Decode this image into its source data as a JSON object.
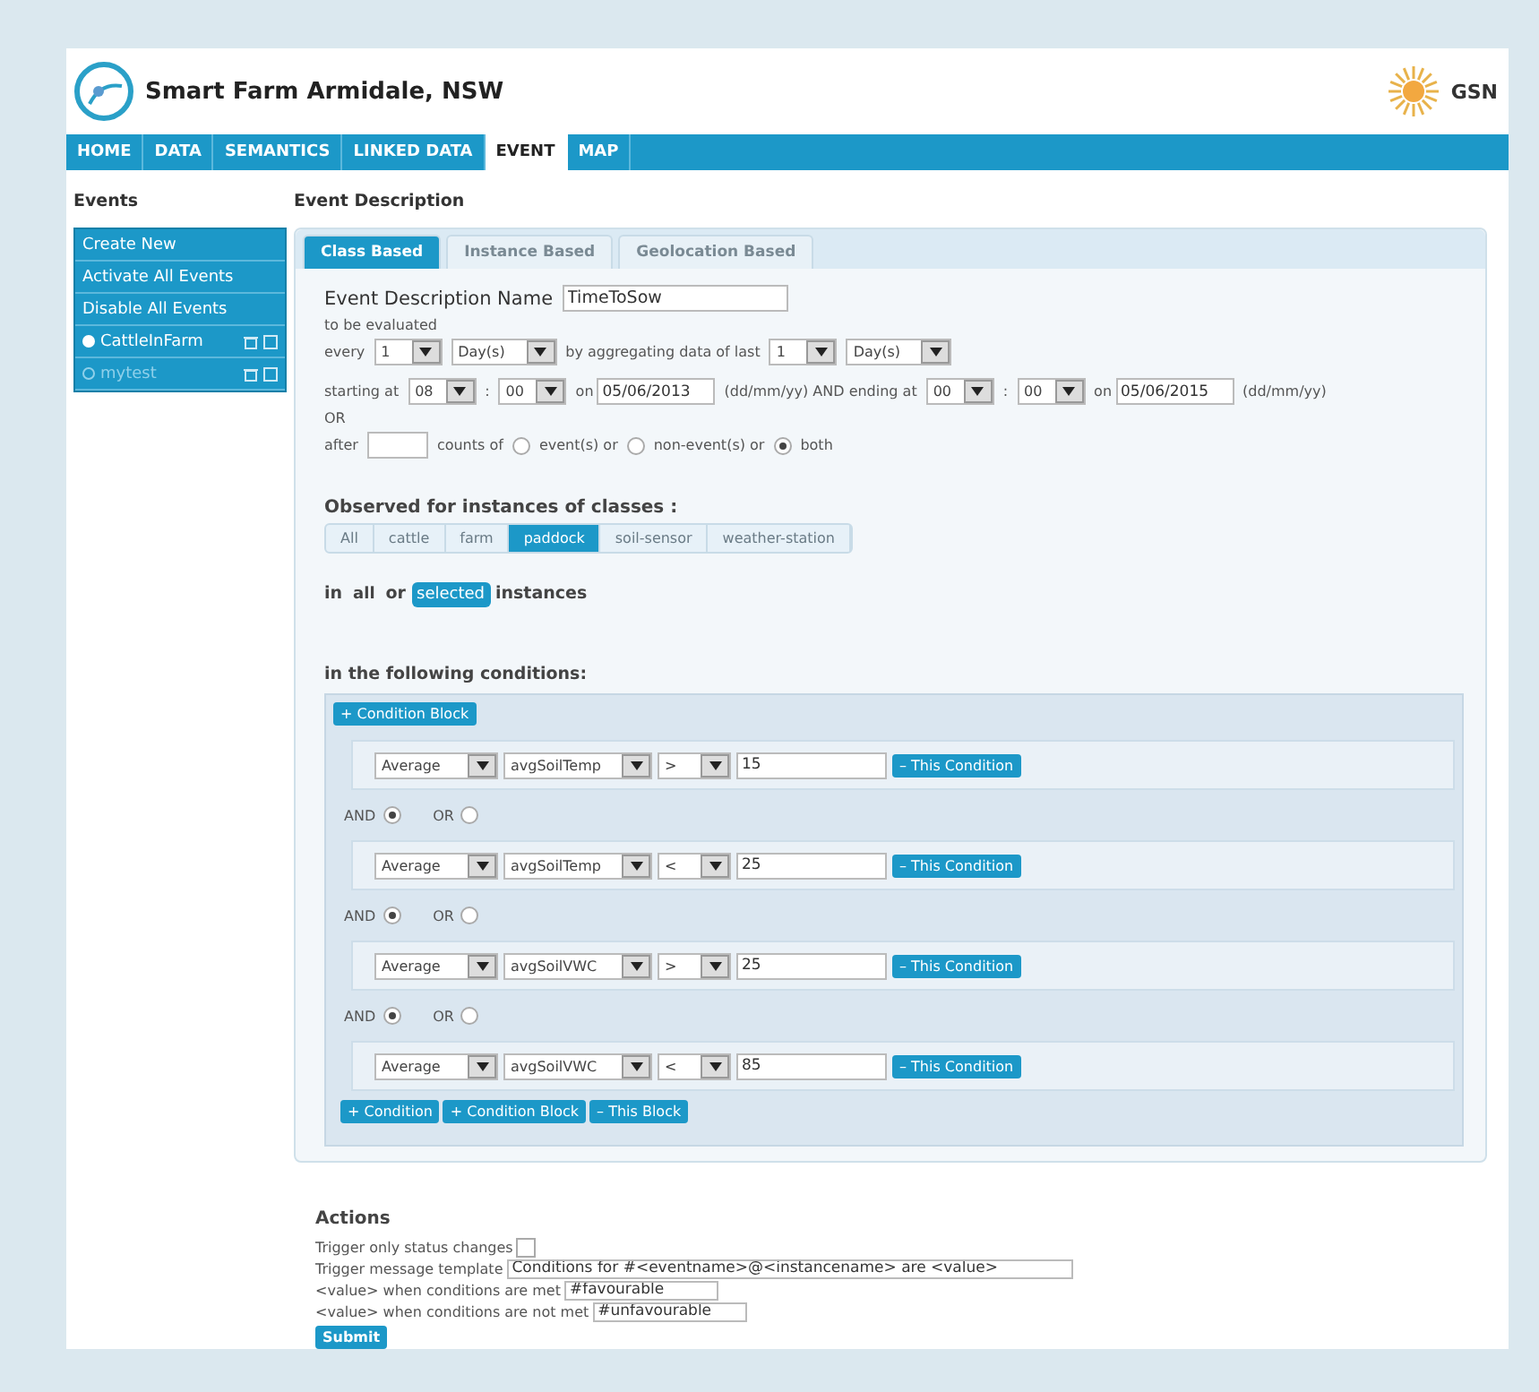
{
  "header": {
    "title": "Smart Farm Armidale, NSW",
    "brand": "GSN"
  },
  "nav": [
    {
      "label": "HOME",
      "selected": false
    },
    {
      "label": "DATA",
      "selected": false
    },
    {
      "label": "SEMANTICS",
      "selected": false
    },
    {
      "label": "LINKED DATA",
      "selected": false
    },
    {
      "label": "EVENT",
      "selected": true
    },
    {
      "label": "MAP",
      "selected": false
    }
  ],
  "sidebar": {
    "title": "Events",
    "actions": [
      "Create New",
      "Activate All Events",
      "Disable All Events"
    ],
    "events": [
      {
        "name": "CattleInFarm",
        "active": true
      },
      {
        "name": "mytest",
        "active": false
      }
    ]
  },
  "main": {
    "title": "Event Description",
    "tabs": [
      {
        "label": "Class Based",
        "selected": true
      },
      {
        "label": "Instance Based",
        "selected": false
      },
      {
        "label": "Geolocation Based",
        "selected": false
      }
    ],
    "name_label": "Event Description Name",
    "name_value": "TimeToSow",
    "evaluated_label": "to be evaluated",
    "every": {
      "label": "every",
      "count": "1",
      "unit": "Day(s)",
      "aggregating_label": "by aggregating data of last",
      "last_count": "1",
      "last_unit": "Day(s)"
    },
    "period": {
      "start_label": "starting at",
      "start_hour": "08",
      "separator": ":",
      "start_minute": "00",
      "on_label": "on",
      "start_date": "05/06/2013",
      "middle_label": "(dd/mm/yy) AND ending at",
      "end_hour": "00",
      "end_separator": ":",
      "end_minute": "00",
      "end_on_label": "on",
      "end_date": "05/06/2015",
      "format_label": "(dd/mm/yy)"
    },
    "or_label": "OR",
    "after": {
      "label": "after",
      "counts_label": "counts of",
      "options": [
        {
          "label": "event(s) or",
          "selected": false
        },
        {
          "label": "non-event(s) or",
          "selected": false
        },
        {
          "label": "both",
          "selected": true
        }
      ]
    },
    "classes_heading": "Observed for instances of classes :",
    "classes": [
      {
        "label": "All",
        "selected": false
      },
      {
        "label": "cattle",
        "selected": false
      },
      {
        "label": "farm",
        "selected": false
      },
      {
        "label": "paddock",
        "selected": true
      },
      {
        "label": "soil-sensor",
        "selected": false
      },
      {
        "label": "weather-station",
        "selected": false
      }
    ],
    "scope": {
      "prefix": "in",
      "options": [
        {
          "label": "all",
          "selected": false
        },
        {
          "label": "selected",
          "selected": true
        }
      ],
      "joiner": "or",
      "suffix": "instances"
    },
    "conditions_heading": "in the following conditions:",
    "block_button": "+ Condition Block",
    "conditions": [
      {
        "aggregate": "Average",
        "variable": "avgSoilTemp",
        "operator": ">",
        "value": "15",
        "remove": "– This Condition"
      },
      {
        "joiner": [
          {
            "label": "AND",
            "selected": true
          },
          {
            "label": "OR",
            "selected": false
          }
        ],
        "aggregate": "Average",
        "variable": "avgSoilTemp",
        "operator": "<",
        "value": "25",
        "remove": "– This Condition"
      },
      {
        "joiner": [
          {
            "label": "AND",
            "selected": true
          },
          {
            "label": "OR",
            "selected": false
          }
        ],
        "aggregate": "Average",
        "variable": "avgSoilVWC",
        "operator": ">",
        "value": "25",
        "remove": "– This Condition"
      },
      {
        "joiner": [
          {
            "label": "AND",
            "selected": true
          },
          {
            "label": "OR",
            "selected": false
          }
        ],
        "aggregate": "Average",
        "variable": "avgSoilVWC",
        "operator": "<",
        "value": "85",
        "remove": "– This Condition"
      }
    ],
    "block_buttons": [
      "+ Condition",
      "+ Condition Block",
      "– This Block"
    ],
    "actions": {
      "heading": "Actions",
      "status_label": "Trigger only status changes",
      "status_checked": false,
      "template_label": "Trigger message template",
      "template_value": "Conditions for #<eventname>@<instancename> are <value>",
      "met_label": "<value> when conditions are met",
      "met_value": "#favourable",
      "not_met_label": "<value> when conditions are not met",
      "not_met_value": "#unfavourable",
      "submit": "Submit"
    }
  }
}
